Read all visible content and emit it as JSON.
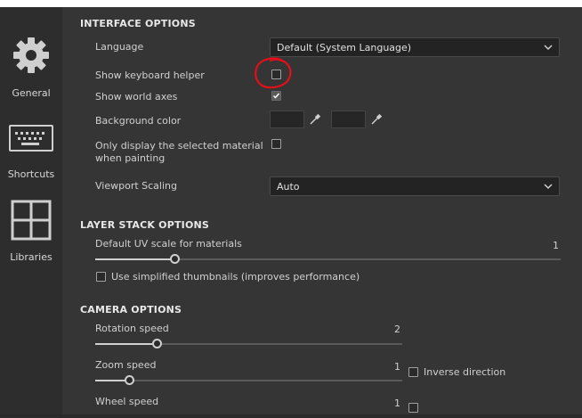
{
  "sidebar": {
    "items": [
      {
        "label": "General",
        "icon": "gear-icon"
      },
      {
        "label": "Shortcuts",
        "icon": "keyboard-icon"
      },
      {
        "label": "Libraries",
        "icon": "grid-icon"
      }
    ]
  },
  "interface": {
    "title": "INTERFACE OPTIONS",
    "language_label": "Language",
    "language_value": "Default (System Language)",
    "keyboard_helper_label": "Show keyboard helper",
    "keyboard_helper_checked": false,
    "world_axes_label": "Show world axes",
    "world_axes_checked": true,
    "background_color_label": "Background color",
    "selected_material_label": "Only display the selected material when painting",
    "selected_material_checked": false,
    "viewport_scaling_label": "Viewport Scaling",
    "viewport_scaling_value": "Auto"
  },
  "layer_stack": {
    "title": "LAYER STACK OPTIONS",
    "uv_scale_label": "Default UV scale for materials",
    "uv_scale_value": "1",
    "uv_scale_fraction": 0.17,
    "simplified_thumbs_label": "Use simplified thumbnails (improves performance)",
    "simplified_thumbs_checked": false
  },
  "camera": {
    "title": "CAMERA OPTIONS",
    "rotation_label": "Rotation speed",
    "rotation_value": "2",
    "rotation_fraction": 0.2,
    "zoom_label": "Zoom speed",
    "zoom_value": "1",
    "zoom_fraction": 0.11,
    "inverse_label": "Inverse direction",
    "inverse_checked": false,
    "wheel_label": "Wheel speed",
    "wheel_value": "1"
  },
  "colors": {
    "annotation": "#e0101a",
    "panel_bg": "#353535",
    "sidebar_bg": "#2d2d2d"
  }
}
